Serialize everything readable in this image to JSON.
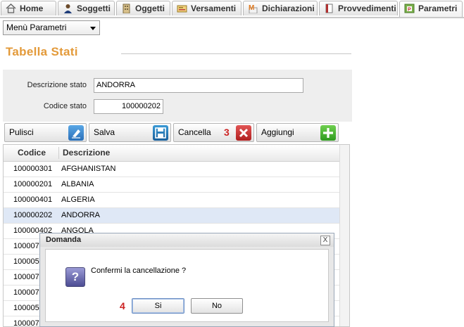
{
  "tabs": [
    {
      "label": "Home",
      "icon": "home-icon"
    },
    {
      "label": "Soggetti",
      "icon": "person-icon"
    },
    {
      "label": "Oggetti",
      "icon": "building-icon"
    },
    {
      "label": "Versamenti",
      "icon": "payment-icon"
    },
    {
      "label": "Dichiarazioni",
      "icon": "declaration-icon"
    },
    {
      "label": "Provvedimenti",
      "icon": "document-icon"
    },
    {
      "label": "Parametri",
      "icon": "parameters-icon"
    }
  ],
  "menu": {
    "label": "Menù Parametri"
  },
  "page_title": "Tabella Stati",
  "form": {
    "descrizione_label": "Descrizione stato",
    "descrizione_value": "ANDORRA",
    "codice_label": "Codice stato",
    "codice_value": "100000202"
  },
  "toolbar": {
    "pulisci": "Pulisci",
    "salva": "Salva",
    "cancella": "Cancella",
    "aggiungi": "Aggiungi",
    "step_cancella": "3"
  },
  "grid": {
    "headers": {
      "codice": "Codice",
      "descrizione": "Descrizione"
    },
    "rows": [
      {
        "codice": "100000301",
        "descrizione": "AFGHANISTAN"
      },
      {
        "codice": "100000201",
        "descrizione": "ALBANIA"
      },
      {
        "codice": "100000401",
        "descrizione": "ALGERIA"
      },
      {
        "codice": "100000202",
        "descrizione": "ANDORRA"
      },
      {
        "codice": "100000402",
        "descrizione": "ANGOLA"
      },
      {
        "codice": "100007",
        "descrizione": ""
      },
      {
        "codice": "100005",
        "descrizione": ""
      },
      {
        "codice": "100007",
        "descrizione": ""
      },
      {
        "codice": "100007",
        "descrizione": ""
      },
      {
        "codice": "100005",
        "descrizione": ""
      },
      {
        "codice": "100007",
        "descrizione": ""
      }
    ]
  },
  "dialog": {
    "title": "Domanda",
    "close": "X",
    "message": "Confermi la cancellazione ?",
    "question_mark": "?",
    "yes": "Si",
    "no": "No",
    "step_yes": "4"
  },
  "colors": {
    "title": "#e39a3a",
    "selected_row": "#dfe8f6",
    "step_number": "#cc2222"
  }
}
